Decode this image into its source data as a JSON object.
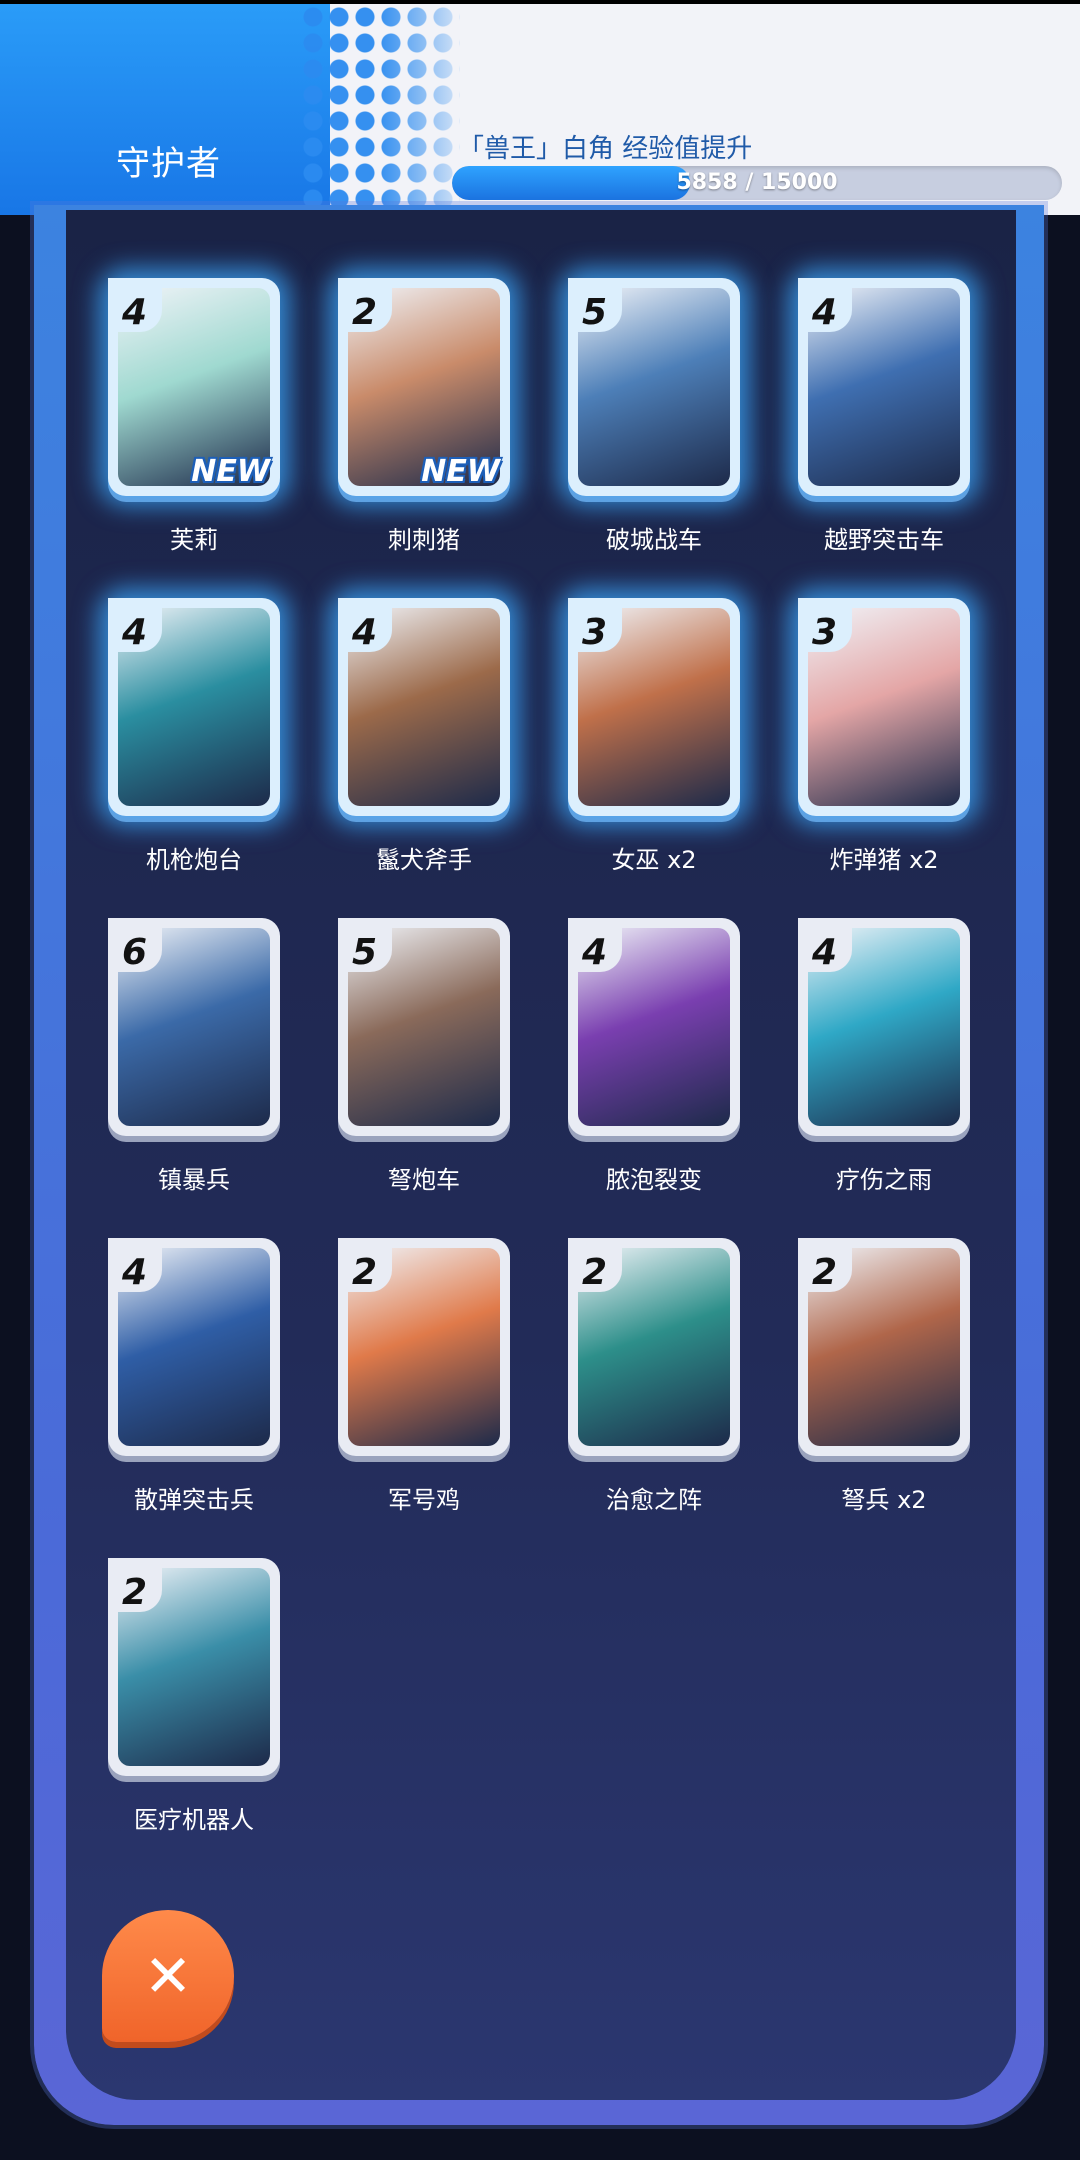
{
  "header": {
    "title": "守护者",
    "quest": "「兽王」白角 经验值提升",
    "progress_text": "5858 / 15000",
    "progress_fraction": 0.3905
  },
  "cards": [
    {
      "cost": "4",
      "name": "芙莉",
      "new": "NEW",
      "glow": true,
      "art": "#9fd9d0"
    },
    {
      "cost": "2",
      "name": "刺刺猪",
      "new": "NEW",
      "glow": true,
      "art": "#c98b6a"
    },
    {
      "cost": "5",
      "name": "破城战车",
      "glow": true,
      "art": "#4d7fb8"
    },
    {
      "cost": "4",
      "name": "越野突击车",
      "glow": true,
      "art": "#3f6fb1"
    },
    {
      "cost": "4",
      "name": "机枪炮台",
      "glow": true,
      "art": "#2a8ea0"
    },
    {
      "cost": "4",
      "name": "鬣犬斧手",
      "glow": true,
      "art": "#9c6a4a"
    },
    {
      "cost": "3",
      "name": "女巫 x2",
      "glow": true,
      "art": "#c0704a"
    },
    {
      "cost": "3",
      "name": "炸弹猪 x2",
      "glow": true,
      "art": "#e4a6a6"
    },
    {
      "cost": "6",
      "name": "镇暴兵",
      "glow": false,
      "art": "#3b6aa8"
    },
    {
      "cost": "5",
      "name": "弩炮车",
      "glow": false,
      "art": "#8a6a5a"
    },
    {
      "cost": "4",
      "name": "脓泡裂变",
      "glow": false,
      "art": "#7a3fb0"
    },
    {
      "cost": "4",
      "name": "疗伤之雨",
      "glow": false,
      "art": "#2fa8c6"
    },
    {
      "cost": "4",
      "name": "散弹突击兵",
      "glow": false,
      "art": "#2f5ea6"
    },
    {
      "cost": "2",
      "name": "军号鸡",
      "glow": false,
      "art": "#e07a4a"
    },
    {
      "cost": "2",
      "name": "治愈之阵",
      "glow": false,
      "art": "#2d8f8a"
    },
    {
      "cost": "2",
      "name": "弩兵 x2",
      "glow": false,
      "art": "#b0664a"
    },
    {
      "cost": "2",
      "name": "医疗机器人",
      "glow": false,
      "art": "#3a8ea8"
    }
  ],
  "close": {
    "label": "✕"
  }
}
